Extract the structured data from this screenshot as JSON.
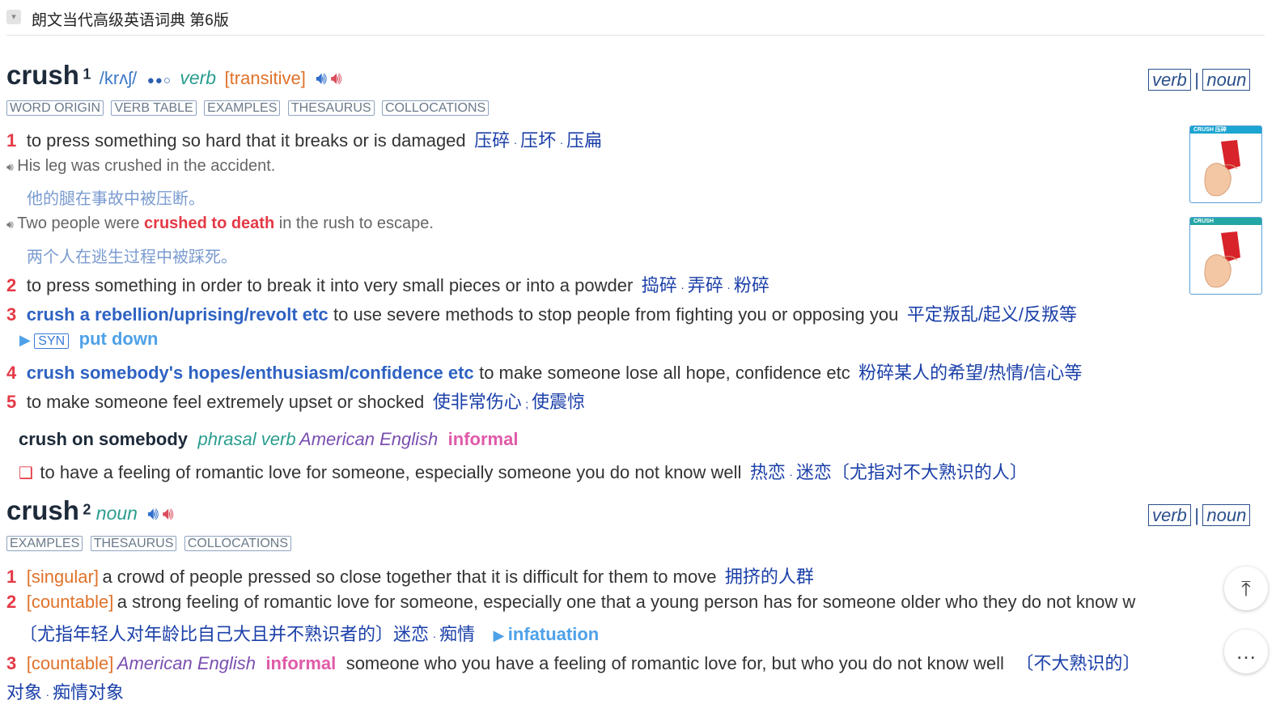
{
  "dict_title": "朗文当代高级英语词典 第6版",
  "pos_switch": {
    "verb": "verb",
    "sep": "|",
    "noun": "noun"
  },
  "entry1": {
    "headword": "crush",
    "homnum": "1",
    "pron": "/krʌʃ/",
    "freq": "●●○",
    "pos": "verb",
    "gram": "[transitive]",
    "tags": [
      "WORD ORIGIN",
      "VERB TABLE",
      "EXAMPLES",
      "THESAURUS",
      "COLLOCATIONS"
    ],
    "senses": [
      {
        "num": "1",
        "def": "to press something so hard that it breaks or is damaged",
        "zh": [
          "压碎",
          "压坏",
          "压扁"
        ]
      },
      {
        "num": "2",
        "def": "to press something in order to break it into very small pieces or into a powder",
        "zh": [
          "捣碎",
          "弄碎",
          "粉碎"
        ]
      },
      {
        "num": "3",
        "lexunit": "crush a rebellion/uprising/revolt etc",
        "def": "to use severe methods to stop people from fighting you or opposing you",
        "zh": [
          "平定叛乱/起义/反叛等"
        ]
      },
      {
        "num": "4",
        "lexunit": "crush somebody's hopes/enthusiasm/confidence etc",
        "def": "to make someone lose all hope, confidence etc",
        "zh": [
          "粉碎某人的希望/热情/信心等"
        ]
      },
      {
        "num": "5",
        "def": "to make someone feel extremely upset or shocked",
        "zh": [
          "使非常伤心",
          "使震惊"
        ]
      }
    ],
    "examples": [
      {
        "en": "His leg was crushed in the accident.",
        "zh": "他的腿在事故中被压断。"
      },
      {
        "en_pre": "Two people were ",
        "en_collo": "crushed to death",
        "en_post": " in the rush to escape.",
        "zh": "两个人在逃生过程中被踩死。"
      }
    ],
    "syn": {
      "label": "SYN",
      "word": "put down"
    },
    "images": [
      {
        "caption": "CRUSH 压碎"
      },
      {
        "caption": "CRUSH"
      }
    ],
    "phrasal": {
      "head": "crush on somebody",
      "pos": "phrasal verb",
      "region": "American English",
      "register": "informal",
      "def": "to have a feeling of romantic love for someone, especially someone you do not know well",
      "zh": [
        "热恋",
        "迷恋〔尤指对不大熟识的人〕"
      ]
    }
  },
  "entry2": {
    "headword": "crush",
    "homnum": "2",
    "pos": "noun",
    "tags": [
      "EXAMPLES",
      "THESAURUS",
      "COLLOCATIONS"
    ],
    "senses": [
      {
        "num": "1",
        "gram": "[singular]",
        "def": "a crowd of people pressed so close together that it is difficult for them to move",
        "zh": "拥挤的人群"
      },
      {
        "num": "2",
        "gram": "[countable]",
        "def": "a strong feeling of romantic love for someone, especially one that a young person has for someone older who they do not know w",
        "zh1": "〔尤指年轻人对年龄比自己大且并不熟识者的〕迷恋",
        "zh2": "痴情",
        "xref": "infatuation"
      },
      {
        "num": "3",
        "gram": "[countable]",
        "region": "American English",
        "register": "informal",
        "def": "someone who you have a feeling of romantic love for, but who you do not know well",
        "zh1": "〔不大熟识的〕",
        "zh1b": "对象",
        "zh2": "痴情对象"
      }
    ]
  },
  "fab": {
    "top_icon": "⤒",
    "chat_icon": "…"
  }
}
